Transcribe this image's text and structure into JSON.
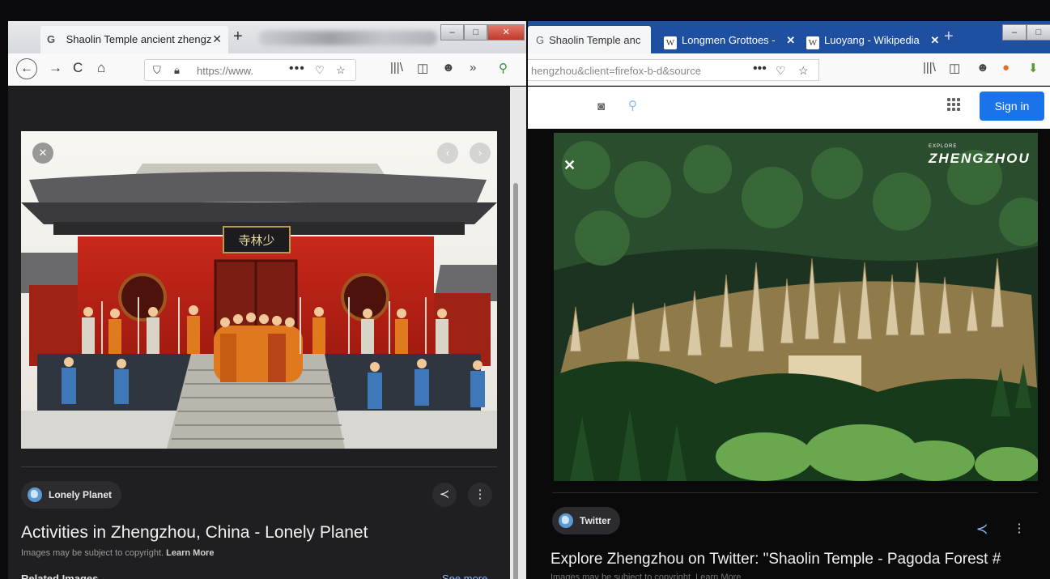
{
  "left_window": {
    "tab": {
      "favicon": "G",
      "title": "Shaolin Temple ancient zhengz",
      "close": "✕"
    },
    "new_tab": "+",
    "window_controls": [
      "–",
      "□",
      "✕"
    ],
    "nav": {
      "back": "←",
      "forward": "→",
      "reload": "C",
      "home": "⌂"
    },
    "url": "https://www.",
    "url_menu": "•••",
    "toolbar_icons": {
      "library": "|||\\",
      "sidebar": "◫",
      "account": "☻",
      "overflow": "»"
    },
    "image_controls": {
      "close": "✕",
      "prev": "‹",
      "next": "›"
    },
    "result": {
      "source": "Lonely Planet",
      "title": "Activities in Zhengzhou, China - Lonely Planet",
      "copyright": "Images may be subject to copyright.",
      "learn_more": "Learn More",
      "related": "Related Images",
      "see_more": "See more"
    },
    "actions": {
      "share": "≺",
      "more": "⋮"
    },
    "temple_sign": "寺林少"
  },
  "right_window": {
    "tabs": [
      {
        "favicon": "G",
        "title": "Shaolin Temple anc",
        "close": "✕",
        "active": true
      },
      {
        "favicon": "W",
        "title": "Longmen Grottoes -",
        "close": "✕",
        "active": false
      },
      {
        "favicon": "W",
        "title": "Luoyang - Wikipedia",
        "close": "✕",
        "active": false
      }
    ],
    "new_tab": "+",
    "window_controls": [
      "–",
      "□"
    ],
    "url": "hengzhou&client=firefox-b-d&source",
    "url_menu": "•••",
    "sign_in": "Sign in",
    "overlay": {
      "small": "EXPLORE",
      "big": "ZHENGZHOU",
      "close": "✕"
    },
    "result": {
      "source": "Twitter",
      "title": "Explore Zhengzhou on Twitter: \"Shaolin Temple - Pagoda Forest #",
      "copyright": "Images may be subject to copyright. Learn More"
    },
    "actions": {
      "share": "≺",
      "more": "⋮"
    }
  },
  "colors": {
    "dark_bg": "#1f1f21",
    "chip_bg": "#2c2c30",
    "link_blue": "#8ab4f8",
    "sign_in_blue": "#1a73e8",
    "firefox_blue": "#1f4fa0"
  }
}
